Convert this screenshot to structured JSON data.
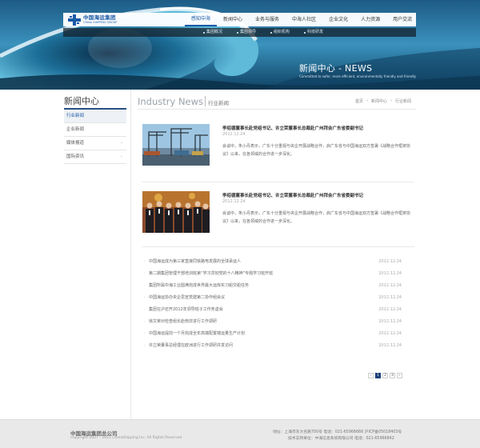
{
  "header": {
    "logo": {
      "cn": "中国海运集团",
      "en": "CHINA SHIPPING GROUP"
    },
    "main_nav": [
      {
        "label": "感知中海",
        "active": true
      },
      {
        "label": "新闻中心",
        "active": false
      },
      {
        "label": "业务与服务",
        "active": false
      },
      {
        "label": "中海人社区",
        "active": false
      },
      {
        "label": "企业文化",
        "active": false
      },
      {
        "label": "人力资源",
        "active": false
      },
      {
        "label": "用户交流",
        "active": false
      }
    ],
    "sub_nav": [
      "集团概况",
      "集团领导",
      "组织机构",
      "科技研发"
    ]
  },
  "banner": {
    "title": "新闻中心 - NEWS",
    "slogan": "Committed to safer, more efficient, environmentally friendly and friendly"
  },
  "sidebar": {
    "title": "新闻中心",
    "items": [
      {
        "label": "行业新闻",
        "active": true,
        "arrow": ""
      },
      {
        "label": "企业新闻",
        "active": false,
        "arrow": ""
      },
      {
        "label": "媒体报道",
        "active": false,
        "arrow": "›"
      },
      {
        "label": "国际资讯",
        "active": false,
        "arrow": "›"
      }
    ]
  },
  "content_header": {
    "en": "Industry News",
    "cn": "行业新闻",
    "breadcrumb": [
      "首页",
      "›",
      "新闻中心",
      "›",
      "行业新闻"
    ]
  },
  "featured": [
    {
      "title": "李绍德董事长赴党组书记、许立荣董事长总裁赴广州拜会广东省委副书记",
      "date": "2012.12.24",
      "summary": "会谈中，朱小丹表示，广东十分重视与央企开展战略合作，启广东省与中国海运双方签署《战略合作框架协议》以来，在各领域的合作进一步深化。",
      "image": "port-cranes-photo"
    },
    {
      "title": "李绍德董事长赴党组书记、许立荣董事长总裁赴广州拜会广东省委副书记",
      "date": "2012.12.24",
      "summary": "会谈中，朱小丹表示，广东十分重视与央企开展战略合作，启广东省与中国海运双方签署《战略合作框架协议》以来，在各领域的合作进一步深化。",
      "image": "group-meeting-photo"
    }
  ],
  "news_list": [
    {
      "title": "中国海运成为第三家直接同铁路电发展的全球承运人",
      "date": "2012.12.24"
    },
    {
      "title": "第二期集团管理干部培训班第“学习贯彻党的十八精神”专题学习班开班",
      "date": "2012.12.24"
    },
    {
      "title": "集团所属中海工业圆满完成世界最大运库实习船交船任务",
      "date": "2012.12.24"
    },
    {
      "title": "中国海运协办央企思宣党建第二协作组会议",
      "date": "2012.12.24"
    },
    {
      "title": "集团在沪召开2012年领导班子工作务虚会",
      "date": "2012.12.24"
    },
    {
      "title": "徐文荣对检查组长赴南非进行工作调研",
      "date": "2012.12.24"
    },
    {
      "title": "中国海运提前一个月完成全年高端配置端运量生产计划",
      "date": "2012.12.24"
    },
    {
      "title": "许立荣董事总经理在欧洲进行工作调研并发访问",
      "date": "2012.12.24"
    }
  ],
  "pagination": {
    "prev": "‹",
    "pages": [
      "1",
      "2",
      "3"
    ],
    "current": "1",
    "next": "›"
  },
  "footer": {
    "company": "中国海运集团总公司",
    "copyright": "Copyright 2007 - 2012 ChinaShipping Inc. All Rights Reserved",
    "address_line": "地址：上海市东大名路700号  电话：021-65966666  沪ICP备05018403号",
    "support_line": "技术支持单位：中海信息系统有限公司  电话：021-65966842"
  }
}
